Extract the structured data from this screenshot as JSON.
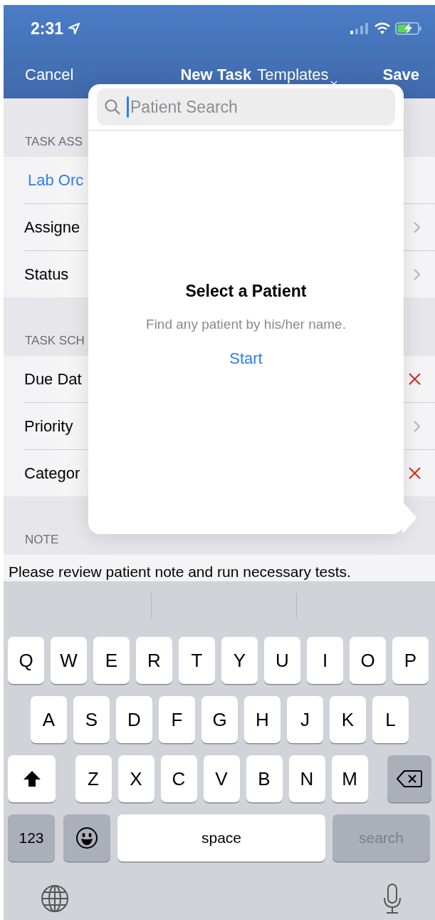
{
  "status_bar": {
    "time": "2:31"
  },
  "nav": {
    "cancel": "Cancel",
    "title": "New Task",
    "templates": "Templates",
    "save": "Save"
  },
  "sections": [
    {
      "header": "TASK ASS",
      "rows": [
        {
          "label": "Lab Orc",
          "kind": "link"
        },
        {
          "label": "Assigne",
          "kind": "chevron"
        },
        {
          "label": "Status",
          "kind": "chevron"
        }
      ]
    },
    {
      "header": "TASK SCH",
      "rows": [
        {
          "label": "Due Dat",
          "kind": "clear"
        },
        {
          "label": "Priority",
          "kind": "chevron"
        },
        {
          "label": "Categor",
          "kind": "clear"
        }
      ]
    },
    {
      "header": "NOTE",
      "note": "Please review patient note and run necessary tests."
    }
  ],
  "popover": {
    "search": {
      "placeholder": "Patient Search",
      "focused": true
    },
    "title": "Select a Patient",
    "subtitle": "Find any patient by his/her name.",
    "start": "Start"
  },
  "keyboard": {
    "rows": [
      [
        "Q",
        "W",
        "E",
        "R",
        "T",
        "Y",
        "U",
        "I",
        "O",
        "P"
      ],
      [
        "A",
        "S",
        "D",
        "F",
        "G",
        "H",
        "J",
        "K",
        "L"
      ],
      [
        "Z",
        "X",
        "C",
        "V",
        "B",
        "N",
        "M"
      ]
    ],
    "numbers": "123",
    "space": "space",
    "action": {
      "label": "search",
      "disabled": true
    }
  }
}
